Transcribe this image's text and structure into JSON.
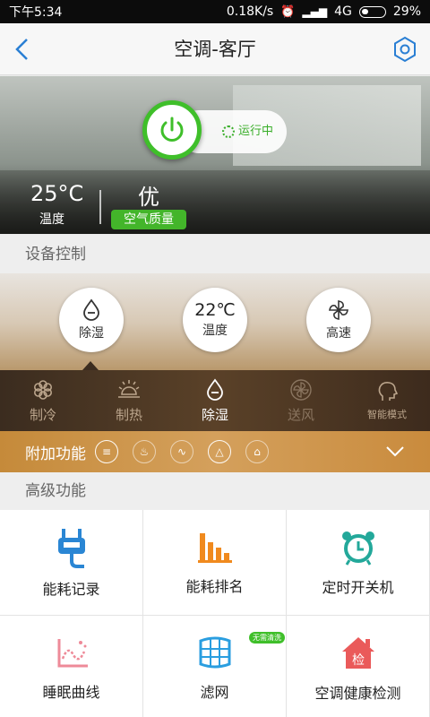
{
  "status": {
    "time": "下午5:34",
    "speed": "0.18K/s",
    "network": "4G",
    "battery": "29%"
  },
  "header": {
    "title": "空调-客厅"
  },
  "hero": {
    "running_label": "运行中",
    "temperature": "25°C",
    "temperature_label": "温度",
    "air_quality": "优",
    "air_quality_label": "空气质量",
    "accent": "#3fbf2a"
  },
  "sections": {
    "device_control": "设备控制",
    "advanced": "高级功能"
  },
  "controls": [
    {
      "label": "除湿",
      "icon": "dehumidify-icon"
    },
    {
      "value": "22℃",
      "label": "温度"
    },
    {
      "label": "高速",
      "icon": "fan-icon"
    }
  ],
  "modes": [
    {
      "label": "制冷",
      "icon": "snowflake-icon",
      "active": false
    },
    {
      "label": "制热",
      "icon": "sun-icon",
      "active": false
    },
    {
      "label": "除湿",
      "icon": "drop-icon",
      "active": true
    },
    {
      "label": "送风",
      "icon": "fan-icon",
      "active": false
    },
    {
      "label": "智能模式",
      "icon": "smart-head-icon",
      "active": false
    }
  ],
  "extra": {
    "label": "附加功能"
  },
  "features": [
    {
      "label": "能耗记录",
      "icon": "plug-icon"
    },
    {
      "label": "能耗排名",
      "icon": "bar-chart-icon"
    },
    {
      "label": "定时开关机",
      "icon": "alarm-clock-icon"
    },
    {
      "label": "睡眠曲线",
      "icon": "sleep-curve-icon"
    },
    {
      "label": "滤网",
      "icon": "filter-net-icon",
      "badge": "无需清洗"
    },
    {
      "label": "空调健康检测",
      "icon": "health-house-icon",
      "icon_text": "检"
    }
  ]
}
